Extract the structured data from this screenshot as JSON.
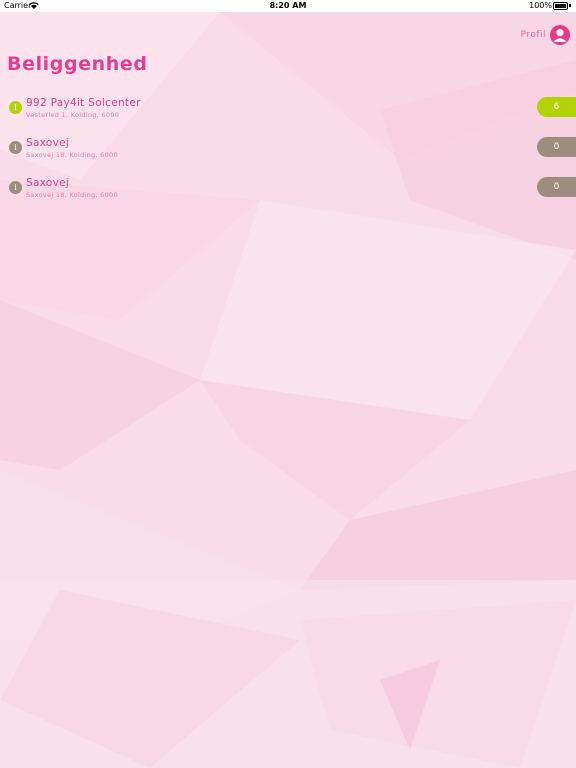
{
  "status_bar": {
    "carrier": "Carrier",
    "time": "8:20 AM",
    "battery": "100%"
  },
  "header": {
    "profile_label": "Profil",
    "title": "Beliggenhed"
  },
  "locations": [
    {
      "name": "992 Pay4it Solcenter",
      "address": "Vesterled 1, Kolding, 6000",
      "count": "6",
      "info": "i",
      "status_color": "#b1d205"
    },
    {
      "name": "Saxovej",
      "address": "Saxovej 18, Kolding, 6000",
      "count": "0",
      "info": "i",
      "status_color": "#9e8c7f"
    },
    {
      "name": "Saxovej",
      "address": "Saxovej 18, Kolding, 6000",
      "count": "0",
      "info": "i",
      "status_color": "#9e8c7f"
    }
  ],
  "colors": {
    "accent": "#e33e90",
    "active": "#b1d205",
    "inactive": "#9e8c7f",
    "background": "#f9dbe9"
  }
}
